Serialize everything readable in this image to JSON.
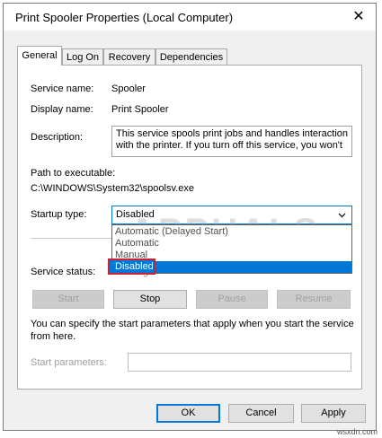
{
  "window": {
    "title": "Print Spooler Properties (Local Computer)",
    "close_glyph": "✕"
  },
  "tabs": [
    {
      "label": "General"
    },
    {
      "label": "Log On"
    },
    {
      "label": "Recovery"
    },
    {
      "label": "Dependencies"
    }
  ],
  "general": {
    "service_name_label": "Service name:",
    "service_name_value": "Spooler",
    "display_name_label": "Display name:",
    "display_name_value": "Print Spooler",
    "description_label": "Description:",
    "description_line1": "This service spools print jobs and handles interaction",
    "description_line2": "with the printer.  If you turn off this service, you won't",
    "path_label": "Path to executable:",
    "path_value": "C:\\WINDOWS\\System32\\spoolsv.exe",
    "startup_type_label": "Startup type:",
    "startup_type_value": "Disabled",
    "startup_options": [
      "Automatic (Delayed Start)",
      "Automatic",
      "Manual",
      "Disabled"
    ],
    "service_status_label": "Service status:",
    "service_status_value": "Running",
    "start_label": "Start",
    "stop_label": "Stop",
    "pause_label": "Pause",
    "resume_label": "Resume",
    "hint_line1": "You can specify the start parameters that apply when you start the service",
    "hint_line2": "from here.",
    "start_params_label": "Start parameters:",
    "start_params_value": ""
  },
  "footer": {
    "ok_label": "OK",
    "cancel_label": "Cancel",
    "apply_label": "Apply"
  },
  "watermark": "APPUALS",
  "site_label": "wsxdn.com",
  "colors": {
    "accent": "#0078d7",
    "highlight_border": "#d0202e"
  }
}
